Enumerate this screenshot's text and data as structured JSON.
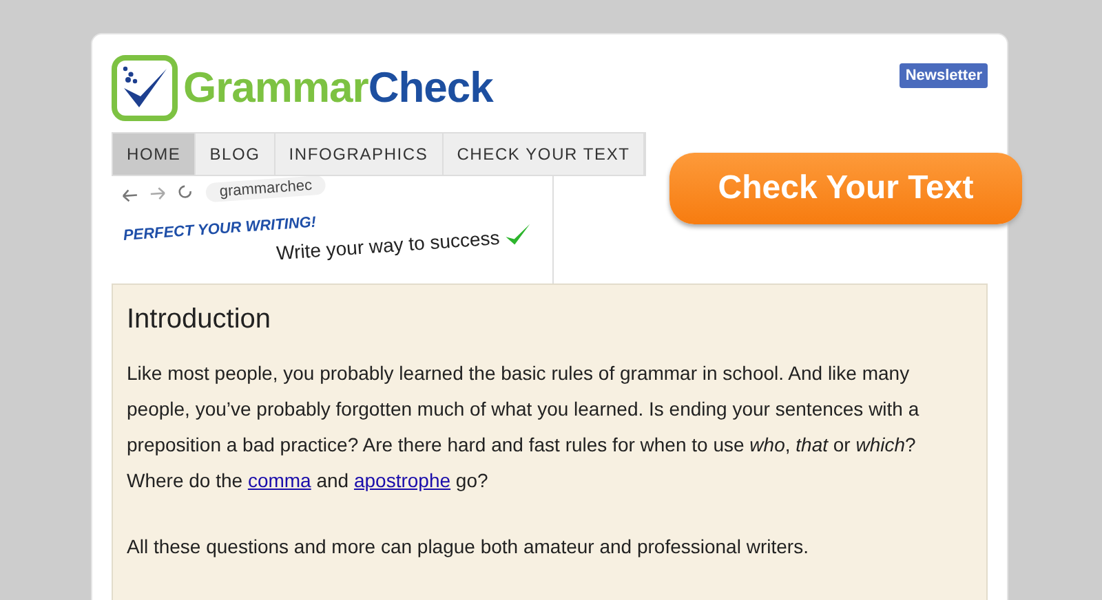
{
  "logo": {
    "part_1": "Grammar",
    "part_2": "Check"
  },
  "newsletter": "Newsletter",
  "nav": [
    {
      "label": "HOME",
      "selected": true
    },
    {
      "label": "BLOG",
      "selected": false
    },
    {
      "label": "INFOGRAPHICS",
      "selected": false
    },
    {
      "label": "CHECK YOUR TEXT",
      "selected": false
    }
  ],
  "banner": {
    "url": "grammarchec",
    "headline": "PERFECT YOUR WRITING!",
    "tagline": "Write your way to success"
  },
  "cta": "Check Your Text",
  "content": {
    "heading": "Introduction",
    "paragraphs": [
      [
        {
          "kind": "text",
          "text": "Like most people, you probably learned the basic rules of grammar in school. And like many people, you’ve probably forgotten much of what you learned. Is ending your sentences with a preposition a bad practice? Are there hard and fast rules for when to use *who*, *that* or *which*? Where do the "
        },
        {
          "kind": "link",
          "text": "comma"
        },
        {
          "kind": "text",
          "text": " and "
        },
        {
          "kind": "link",
          "text": "apostrophe"
        },
        {
          "kind": "text",
          "text": " go?"
        }
      ],
      [
        {
          "kind": "text",
          "text": "All these questions and more can plague both amateur and professional writers."
        }
      ]
    ]
  }
}
